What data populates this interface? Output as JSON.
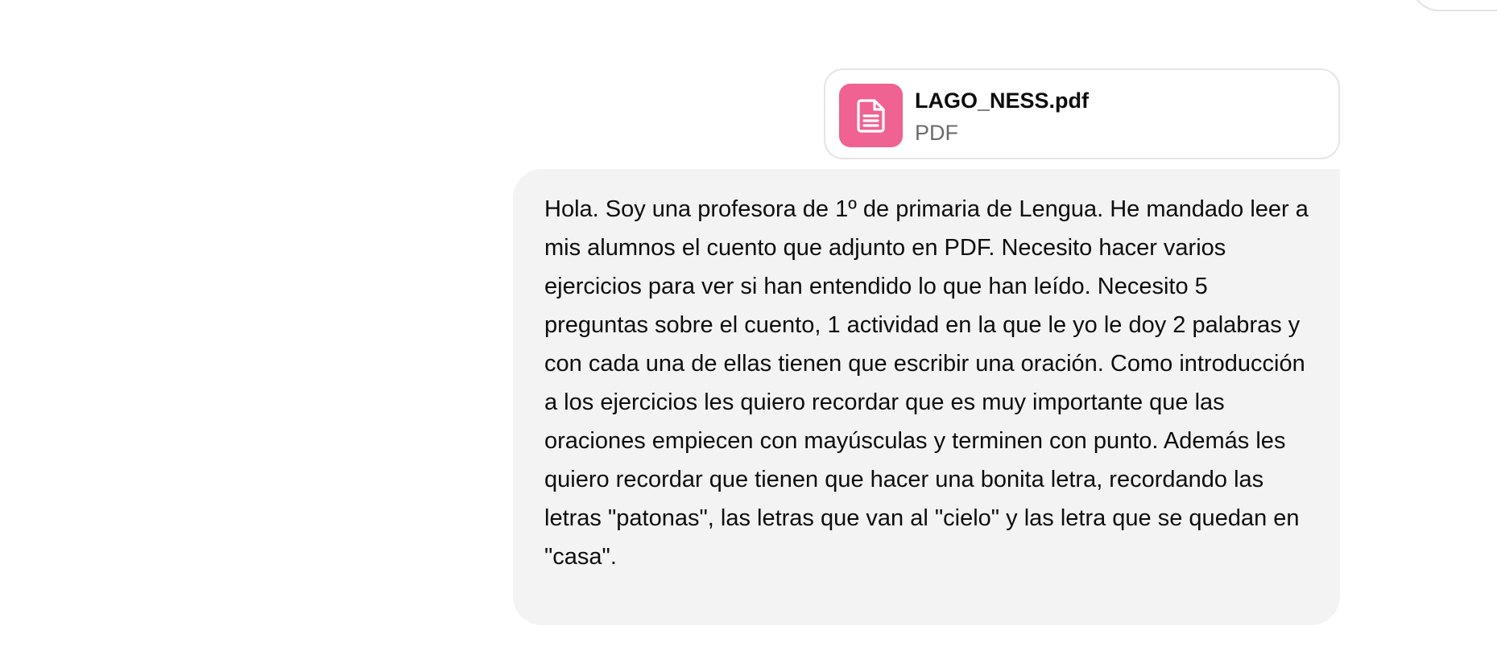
{
  "attachment": {
    "file_name": "LAGO_NESS.pdf",
    "file_type": "PDF",
    "icon": "file-text-icon",
    "icon_bg_color": "#ef6291"
  },
  "message": {
    "text": "Hola. Soy una profesora de 1º de primaria de Lengua. He mandado leer a mis alumnos el cuento que adjunto en PDF. Necesito hacer varios ejercicios para ver si han entendido lo que han leído. Necesito 5 preguntas sobre el cuento, 1 actividad en la que le yo le doy 2 palabras y con cada una de ellas tienen que escribir una oración. Como introducción a los ejercicios les quiero recordar que es muy importante que las oraciones empiecen con mayúsculas y terminen con punto. Además les quiero recordar que tienen que hacer una bonita letra, recordando las letras \"patonas\", las letras que van al \"cielo\" y las letra que se quedan en \"casa\".",
    "bubble_color": "#f3f3f3"
  }
}
